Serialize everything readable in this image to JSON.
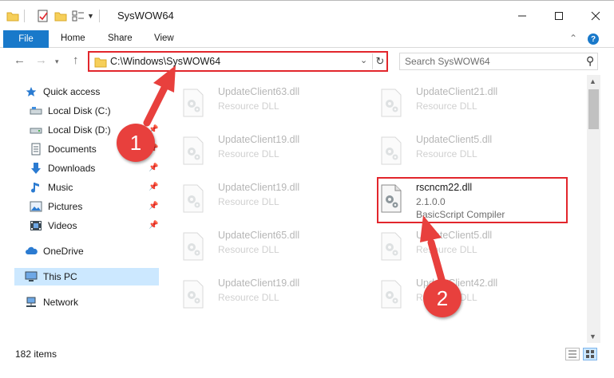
{
  "window": {
    "title": "SysWOW64"
  },
  "ribbon": {
    "tabs": [
      "File",
      "Home",
      "Share",
      "View"
    ],
    "help_label": "?"
  },
  "address": {
    "path": "C:\\Windows\\SysWOW64",
    "search_placeholder": "Search SysWOW64"
  },
  "sidebar": {
    "items": [
      {
        "label": "Quick access",
        "icon": "star-icon"
      },
      {
        "label": "Local Disk (C:)",
        "icon": "drive-icon",
        "pinned": true
      },
      {
        "label": "Local Disk (D:)",
        "icon": "drive-icon",
        "pinned": true
      },
      {
        "label": "Documents",
        "icon": "documents-icon",
        "pinned": true
      },
      {
        "label": "Downloads",
        "icon": "download-icon",
        "pinned": true
      },
      {
        "label": "Music",
        "icon": "music-icon",
        "pinned": true
      },
      {
        "label": "Pictures",
        "icon": "pictures-icon",
        "pinned": true
      },
      {
        "label": "Videos",
        "icon": "videos-icon",
        "pinned": true
      },
      {
        "label": "OneDrive",
        "icon": "cloud-icon"
      },
      {
        "label": "This PC",
        "icon": "computer-icon",
        "selected": true
      },
      {
        "label": "Network",
        "icon": "network-icon"
      }
    ]
  },
  "files": [
    {
      "name": "UpdateClient63.dll",
      "type": "Resource DLL",
      "faded": true
    },
    {
      "name": "UpdateClient21.dll",
      "type": "Resource DLL",
      "faded": true
    },
    {
      "name": "UpdateClient19.dll",
      "type": "Resource DLL",
      "faded": true
    },
    {
      "name": "UpdateClient5.dll",
      "type": "Resource DLL",
      "faded": true
    },
    {
      "name": "UpdateClient19.dll",
      "type": "Resource DLL",
      "faded": true
    },
    {
      "name": "rscncm22.dll",
      "version": "2.1.0.0",
      "description": "BasicScript Compiler",
      "faded": false
    },
    {
      "name": "UpdateClient65.dll",
      "type": "Resource DLL",
      "faded": true
    },
    {
      "name": "UpdateClient5.dll",
      "type": "Resource DLL",
      "faded": true
    },
    {
      "name": "UpdateClient19.dll",
      "type": "Resource DLL",
      "faded": true
    },
    {
      "name": "UpdateClient42.dll",
      "type": "Resource DLL",
      "faded": true
    }
  ],
  "status": {
    "item_count": "182 items"
  },
  "annotations": {
    "step1": "1",
    "step2": "2"
  },
  "colors": {
    "accent": "#1979ca",
    "highlight_red": "#e2262c",
    "badge_red": "#e8403d",
    "selection": "#cce8ff"
  }
}
